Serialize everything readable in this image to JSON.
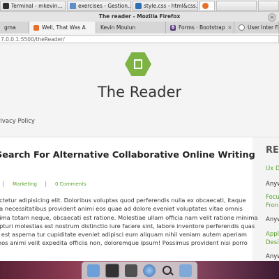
{
  "os_taskbar": {
    "tasks": [
      {
        "label": "Terminal - mkevin...",
        "icon": "terminal-icon"
      },
      {
        "label": "exercises - Gestion...",
        "icon": "folder-icon"
      },
      {
        "label": "style.css - html&css...",
        "icon": "code-editor-icon"
      },
      {
        "label": "",
        "icon": "firefox-icon"
      }
    ]
  },
  "window": {
    "title": "The reader - Mozilla Firefox",
    "close": "×"
  },
  "tabs": [
    {
      "label": "gma",
      "favicon": "figma-icon"
    },
    {
      "label": "Well, That Was A",
      "favicon": "blog-icon"
    },
    {
      "label": "Kevin Moulun",
      "favicon": ""
    },
    {
      "label": "Forms · Bootstrap",
      "favicon": "bootstrap-icon"
    },
    {
      "label": "User Inter Fa",
      "favicon": "globe-icon"
    }
  ],
  "address_bar": {
    "url": "7.0.0.1:5500/theReader/"
  },
  "site": {
    "title": "The Reader",
    "nav_privacy": "rivacy Policy",
    "accent": "#7cb342"
  },
  "post": {
    "title": "Search For Alternative Collaborative Online Writing",
    "category": "Marketing",
    "comments": "0 Comments",
    "excerpt_lines": [
      "ectetur adipisicing elit. Doloribus voluptas quod perferendis nulla ex obcaecati, itaque",
      "ea necessitatibus provident animi eos quae ad dolore eveniet voluptates vitae omnis",
      "nima totam neque, obcaecati est ratione. Molestiae ullam officia nam velit ratione minima",
      "epturi molestias est nostrum distinctio iure facere sint, labore inventore perferendis quas",
      "a est asperna tur cupiditate eveniet adipisci eum aliquam nihil veniam autem aperiam",
      "mos animi velit expedita officiis non, doloremque ipsum! Possimus provident nisi porro"
    ]
  },
  "sidebar": {
    "heading": "REA",
    "links": [
      {
        "text": "Ux D",
        "color": "green"
      },
      {
        "text": "Anyw",
        "color": "dark"
      },
      {
        "text": "Focu",
        "color": "green"
      },
      {
        "text": "Fron",
        "color": "green"
      },
      {
        "text": "Anyw",
        "color": "dark"
      },
      {
        "text": "Appl",
        "color": "green"
      },
      {
        "text": "Desig",
        "color": "green"
      },
      {
        "text": "Anyw",
        "color": "dark"
      }
    ]
  },
  "dock": {
    "items": [
      "folder-icon",
      "terminal-icon",
      "audio-mixer-icon",
      "web-browser-icon",
      "search-icon",
      "file-manager-icon"
    ]
  }
}
